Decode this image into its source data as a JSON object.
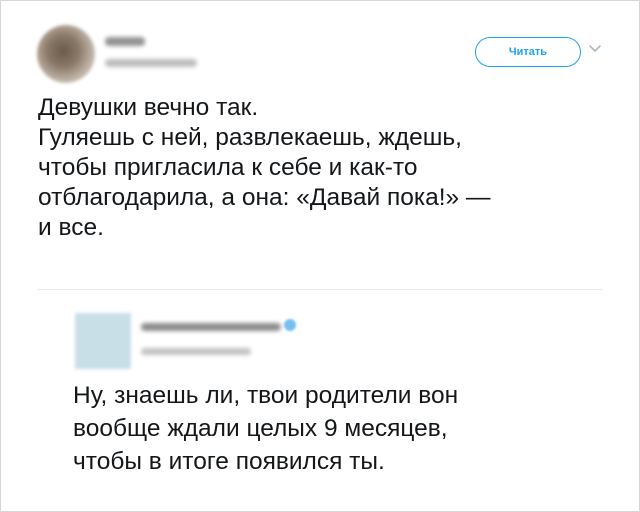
{
  "tweet": {
    "follow_label": "Читать",
    "chevron_icon": "chevron-down-icon",
    "lines": [
      "Девушки вечно так.",
      "Гуляешь с ней, развлекаешь, ждешь,",
      "чтобы пригласила к себе и как-то",
      "отблагодарила, а она: «Давай пока!» —",
      "и все."
    ]
  },
  "reply": {
    "verified_icon": "verified-badge-icon",
    "lines": [
      "Ну, знаешь ли, твои родители вон",
      "вообще ждали целых 9 месяцев,",
      "чтобы в итоге появился ты."
    ]
  },
  "colors": {
    "accent": "#1da1f2",
    "text": "#14171a",
    "divider": "#e1e8ed"
  }
}
